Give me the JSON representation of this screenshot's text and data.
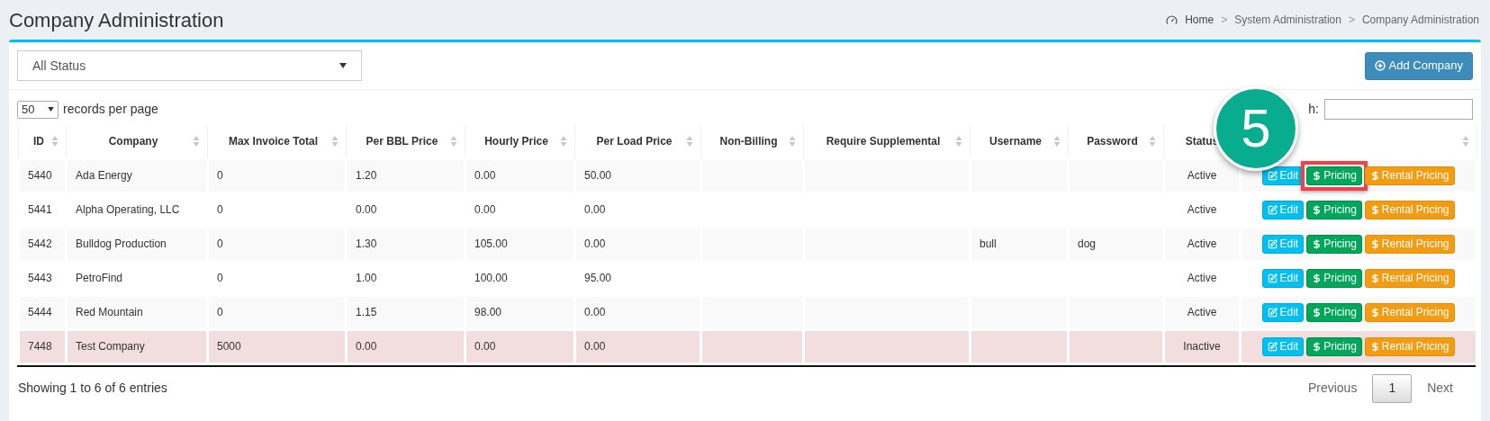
{
  "page": {
    "title": "Company Administration"
  },
  "breadcrumb": {
    "separator": ">",
    "items": [
      {
        "label": "Home"
      },
      {
        "label": "System Administration"
      },
      {
        "label": "Company Administration"
      }
    ]
  },
  "status_filter": {
    "value": "All Status"
  },
  "add_button": {
    "label": "Add Company"
  },
  "page_length": {
    "value": "50",
    "label": "records per page"
  },
  "search": {
    "label": "h:"
  },
  "columns": [
    {
      "label": "ID"
    },
    {
      "label": "Company"
    },
    {
      "label": "Max Invoice Total"
    },
    {
      "label": "Per BBL Price"
    },
    {
      "label": "Hourly Price"
    },
    {
      "label": "Per Load Price"
    },
    {
      "label": "Non-Billing"
    },
    {
      "label": "Require Supplemental"
    },
    {
      "label": "Username"
    },
    {
      "label": "Password"
    },
    {
      "label": "Status",
      "sort_icon": false
    },
    {}
  ],
  "rows": [
    {
      "inactive": false,
      "cells": [
        "5440",
        "Ada Energy",
        "0",
        "1.20",
        "0.00",
        "50.00",
        "",
        "",
        "",
        "",
        "Active"
      ],
      "actions": [
        {
          "kind": "edit",
          "label": "Edit",
          "highlighted": false
        },
        {
          "kind": "pricing",
          "label": "Pricing",
          "highlighted": true
        },
        {
          "kind": "rental",
          "label": "Rental Pricing",
          "highlighted": false
        }
      ]
    },
    {
      "inactive": false,
      "cells": [
        "5441",
        "Alpha Operating, LLC",
        "0",
        "0.00",
        "0.00",
        "0.00",
        "",
        "",
        "",
        "",
        "Active"
      ],
      "actions": [
        {
          "kind": "edit",
          "label": "Edit",
          "highlighted": false
        },
        {
          "kind": "pricing",
          "label": "Pricing",
          "highlighted": false
        },
        {
          "kind": "rental",
          "label": "Rental Pricing",
          "highlighted": false
        }
      ]
    },
    {
      "inactive": false,
      "cells": [
        "5442",
        "Bulldog Production",
        "0",
        "1.30",
        "105.00",
        "0.00",
        "",
        "",
        "bull",
        "dog",
        "Active"
      ],
      "actions": [
        {
          "kind": "edit",
          "label": "Edit",
          "highlighted": false
        },
        {
          "kind": "pricing",
          "label": "Pricing",
          "highlighted": false
        },
        {
          "kind": "rental",
          "label": "Rental Pricing",
          "highlighted": false
        }
      ]
    },
    {
      "inactive": false,
      "cells": [
        "5443",
        "PetroFind",
        "0",
        "1.00",
        "100.00",
        "95.00",
        "",
        "",
        "",
        "",
        "Active"
      ],
      "actions": [
        {
          "kind": "edit",
          "label": "Edit",
          "highlighted": false
        },
        {
          "kind": "pricing",
          "label": "Pricing",
          "highlighted": false
        },
        {
          "kind": "rental",
          "label": "Rental Pricing",
          "highlighted": false
        }
      ]
    },
    {
      "inactive": false,
      "cells": [
        "5444",
        "Red Mountain",
        "0",
        "1.15",
        "98.00",
        "0.00",
        "",
        "",
        "",
        "",
        "Active"
      ],
      "actions": [
        {
          "kind": "edit",
          "label": "Edit",
          "highlighted": false
        },
        {
          "kind": "pricing",
          "label": "Pricing",
          "highlighted": false
        },
        {
          "kind": "rental",
          "label": "Rental Pricing",
          "highlighted": false
        }
      ]
    },
    {
      "inactive": true,
      "cells": [
        "7448",
        "Test Company",
        "5000",
        "0.00",
        "0.00",
        "0.00",
        "",
        "",
        "",
        "",
        "Inactive"
      ],
      "actions": [
        {
          "kind": "edit",
          "label": "Edit",
          "highlighted": false
        },
        {
          "kind": "pricing",
          "label": "Pricing",
          "highlighted": false
        },
        {
          "kind": "rental",
          "label": "Rental Pricing",
          "highlighted": false
        }
      ]
    }
  ],
  "info": "Showing 1 to 6 of 6 entries",
  "pagination": [
    {
      "label": "Previous",
      "selected": false
    },
    {
      "label": "1",
      "selected": true
    },
    {
      "label": "Next",
      "selected": false
    }
  ],
  "callout": {
    "number": "5"
  }
}
